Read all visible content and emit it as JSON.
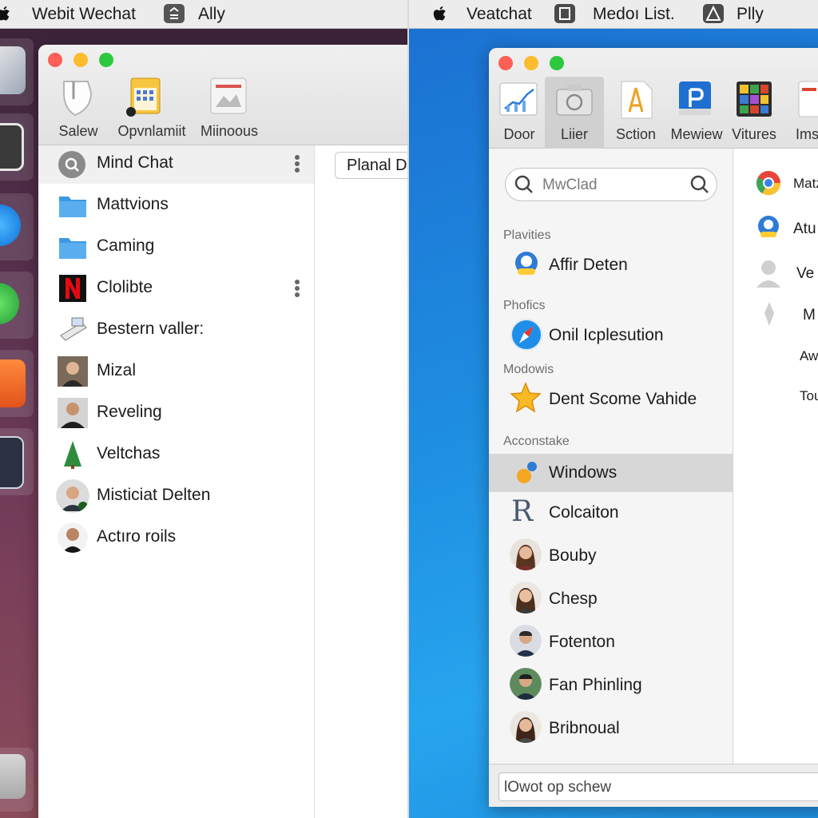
{
  "left_menubar": {
    "app_title": "Webit Wechat",
    "item": "Ally"
  },
  "left_window": {
    "toolbar": [
      {
        "label": "Salew"
      },
      {
        "label": "Opvnlamiit"
      },
      {
        "label": "Miinoous"
      }
    ],
    "search_field": "Planal D",
    "list": [
      {
        "label": "Mind Chat"
      },
      {
        "label": "Mattvions"
      },
      {
        "label": "Caming"
      },
      {
        "label": "Clolibte"
      },
      {
        "label": "Bestern valler:"
      },
      {
        "label": "Mizal"
      },
      {
        "label": "Reveling"
      },
      {
        "label": "Veltchas"
      },
      {
        "label": "Misticiat Delten"
      },
      {
        "label": "Actıro roils"
      }
    ]
  },
  "right_menubar": {
    "app_title": "Veatchat",
    "item1": "Medoı List.",
    "item2": "Plly"
  },
  "right_window": {
    "toolbar": [
      {
        "label": "Door"
      },
      {
        "label": "Liier"
      },
      {
        "label": "Sction"
      },
      {
        "label": "Mewiew"
      },
      {
        "label": "Vitures"
      },
      {
        "label": "Ims"
      }
    ],
    "search": {
      "placeholder": "MwClad"
    },
    "sections": [
      {
        "head": "Plavities",
        "items": [
          "Affir Deten"
        ]
      },
      {
        "head": "Phofics",
        "items": [
          "Onil Icplesution"
        ]
      },
      {
        "head": "Modowis",
        "items": [
          "Dent Scome Vahide"
        ]
      },
      {
        "head": "Acconstake",
        "items": [
          "Windows",
          "Colcaiton",
          "Bouby",
          "Chesp",
          "Fotenton",
          "Fan Phinling",
          "Bribnoual"
        ]
      }
    ],
    "detail": [
      "Matz",
      "Atu",
      "Ve",
      "M",
      "Aw",
      "Tou"
    ],
    "bottom_field": "lOwot op schew"
  }
}
